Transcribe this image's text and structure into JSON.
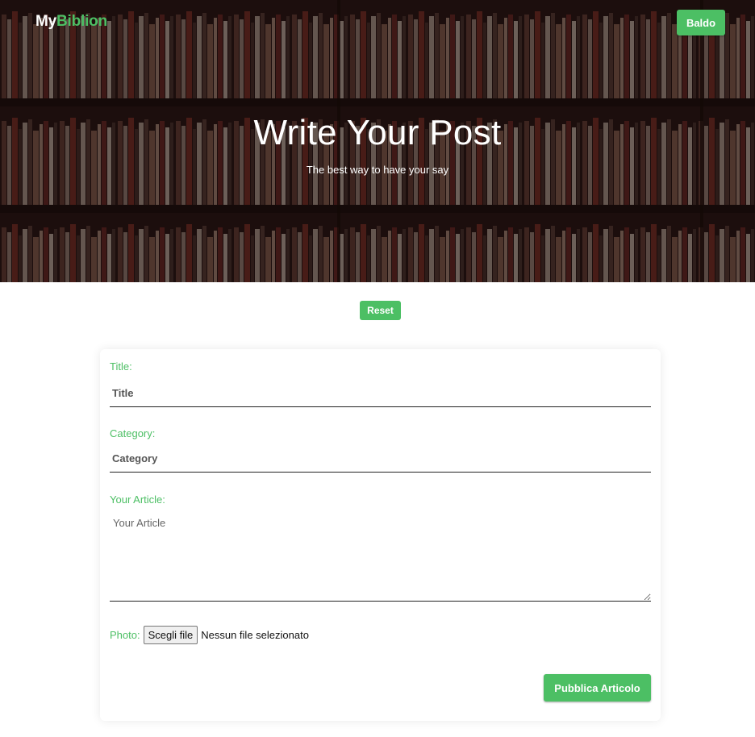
{
  "nav": {
    "brand_my": "My",
    "brand_biblion": "Biblion",
    "user_label": "Baldo"
  },
  "hero": {
    "title": "Write Your Post",
    "subtitle": "The best way to have your say"
  },
  "reset_label": "Reset",
  "form": {
    "title_label": "Title:",
    "title_placeholder": "Title",
    "category_label": "Category:",
    "category_placeholder": "Category",
    "article_label": "Your Article:",
    "article_placeholder": "Your Article",
    "photo_label": "Photo:",
    "file_button_label": "Scegli file",
    "file_status": "Nessun file selezionato",
    "submit_label": "Pubblica Articolo"
  },
  "colors": {
    "accent": "#4cbf64",
    "hero_overlay": "#2a1a16"
  }
}
